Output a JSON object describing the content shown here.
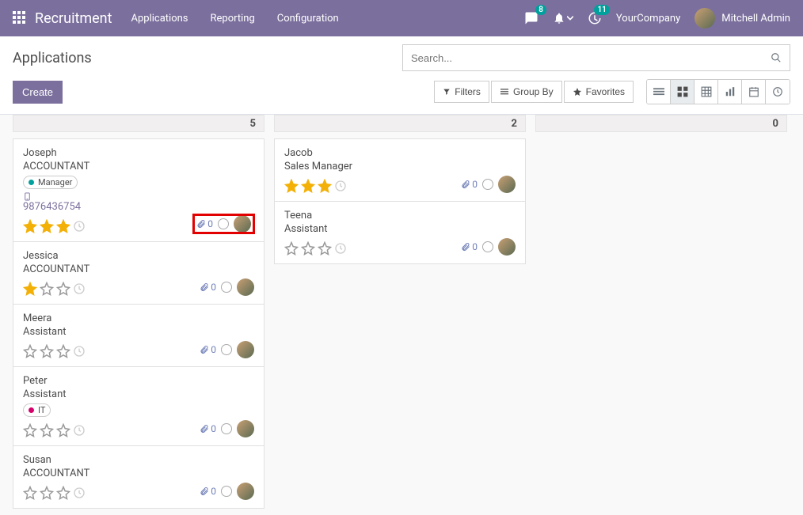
{
  "nav": {
    "brand": "Recruitment",
    "links": [
      "Applications",
      "Reporting",
      "Configuration"
    ],
    "msg_badge": "8",
    "activity_badge": "11",
    "company": "YourCompany",
    "user": "Mitchell Admin"
  },
  "cp": {
    "title": "Applications",
    "create": "Create",
    "search_placeholder": "Search...",
    "filters": "Filters",
    "groupby": "Group By",
    "favorites": "Favorites"
  },
  "columns": [
    {
      "count": "5",
      "cards": [
        {
          "name": "Joseph",
          "title": "ACCOUNTANT",
          "tag": {
            "label": "Manager",
            "color": "#00a09d"
          },
          "phone": "9876436754",
          "stars": 3,
          "attach": "0",
          "highlight_footer": true
        },
        {
          "name": "Jessica",
          "title": "ACCOUNTANT",
          "stars": 1,
          "attach": "0"
        },
        {
          "name": "Meera",
          "title": "Assistant",
          "stars": 0,
          "attach": "0"
        },
        {
          "name": "Peter",
          "title": "Assistant",
          "tag": {
            "label": "IT",
            "color": "#d6006c"
          },
          "stars": 0,
          "attach": "0"
        },
        {
          "name": "Susan",
          "title": "ACCOUNTANT",
          "stars": 0,
          "attach": "0"
        }
      ]
    },
    {
      "count": "2",
      "cards": [
        {
          "name": "Jacob",
          "title": "Sales Manager",
          "stars": 3,
          "attach": "0"
        },
        {
          "name": "Teena",
          "title": "Assistant",
          "stars": 0,
          "attach": "0"
        }
      ]
    },
    {
      "count": "0",
      "cards": []
    }
  ]
}
